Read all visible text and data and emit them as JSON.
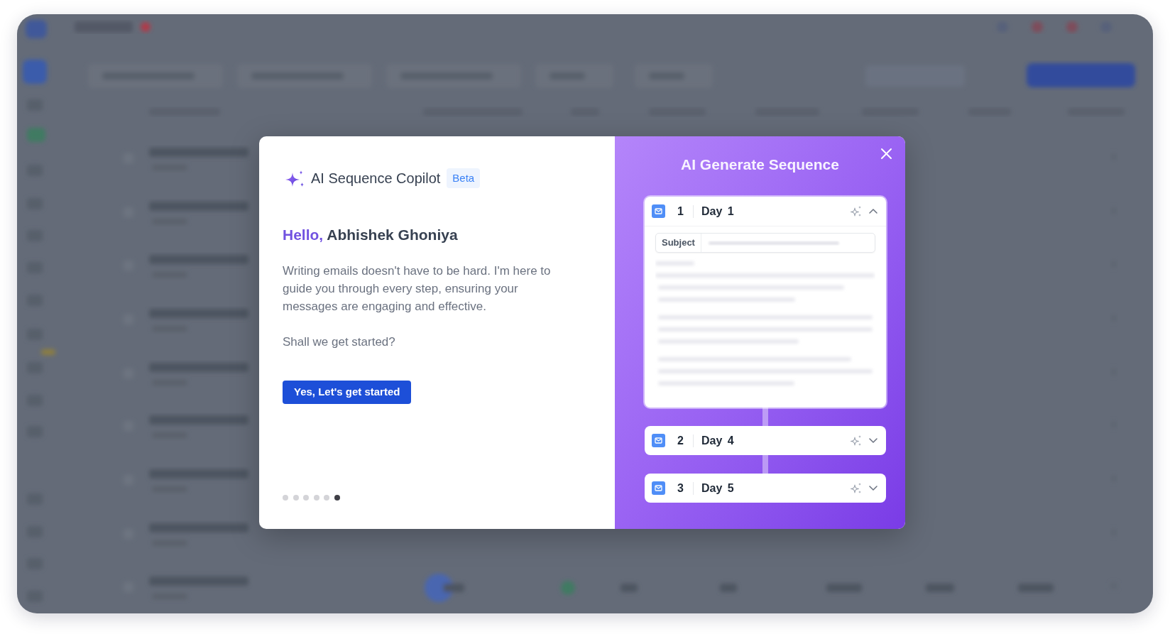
{
  "copilot_panel": {
    "title": "AI Sequence Copilot",
    "badge": "Beta",
    "greeting": "Hello,",
    "name": "Abhishek Ghoniya",
    "message": "Writing emails doesn't have to be hard. I'm here to guide you through every step, ensuring your messages are engaging and effective.",
    "question": "Shall we get started?",
    "button": "Yes, Let's get started",
    "pages": [
      {
        "selected": false
      },
      {
        "selected": false
      },
      {
        "selected": false
      },
      {
        "selected": false
      },
      {
        "selected": false
      },
      {
        "selected": true
      }
    ]
  },
  "preview_panel": {
    "title": "AI Generate Sequence",
    "steps": [
      {
        "number": "1",
        "label": "Day 1",
        "expanded": true,
        "subject_label": "Subject"
      },
      {
        "number": "2",
        "label": "Day 4",
        "expanded": false
      },
      {
        "number": "3",
        "label": "Day 5",
        "expanded": false
      }
    ]
  }
}
